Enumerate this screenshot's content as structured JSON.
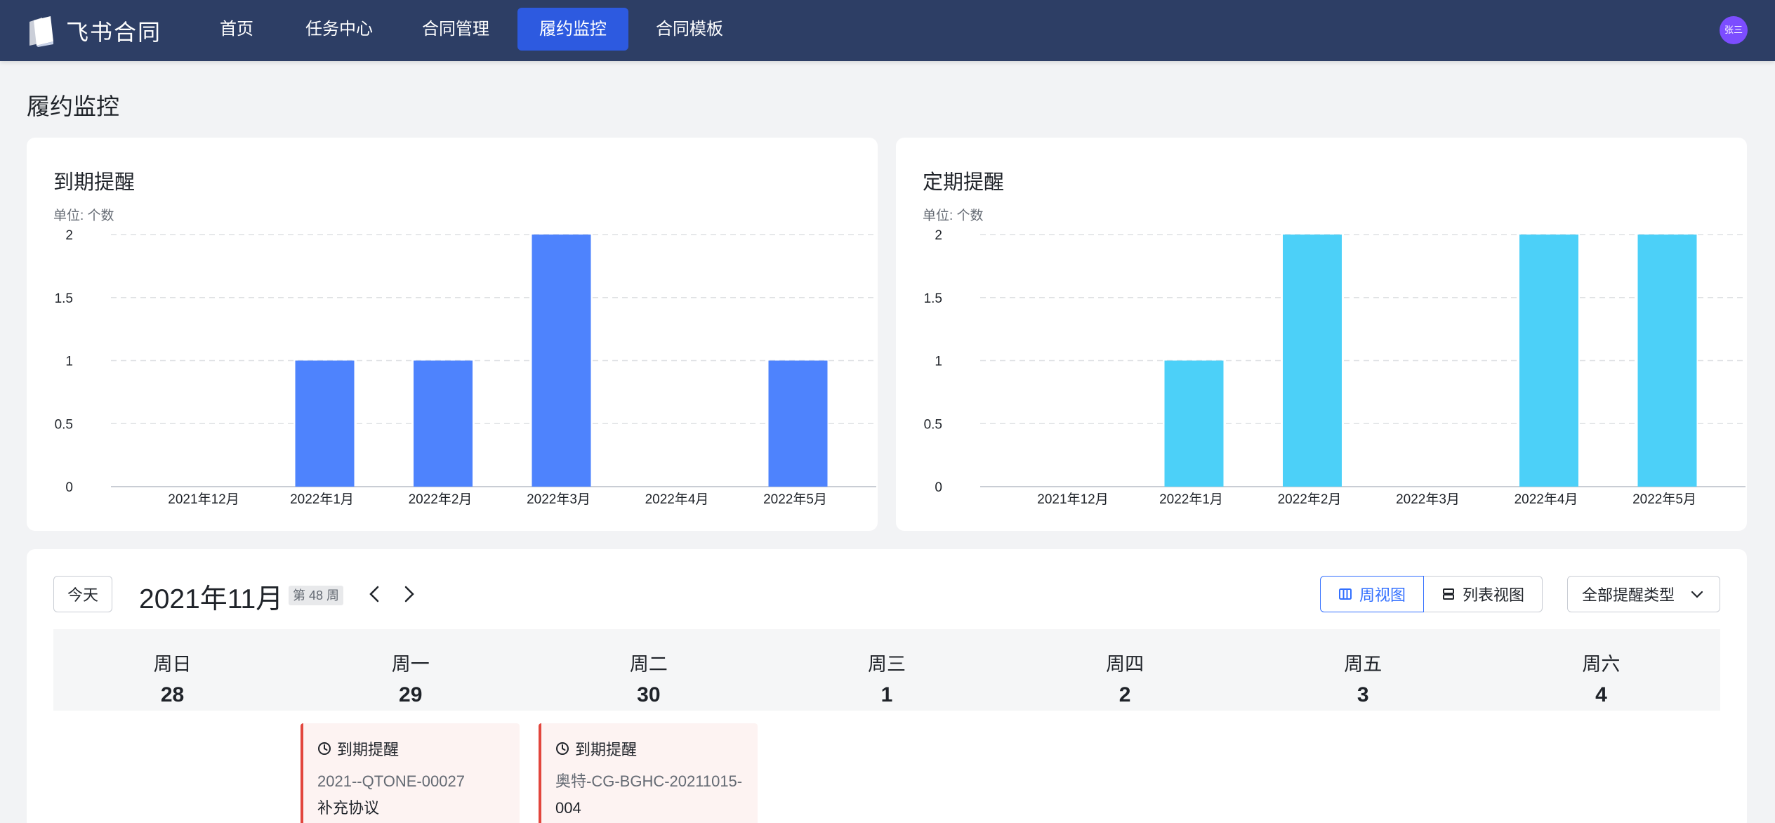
{
  "app": {
    "name": "飞书合同"
  },
  "nav": [
    {
      "label": "首页",
      "active": false
    },
    {
      "label": "任务中心",
      "active": false
    },
    {
      "label": "合同管理",
      "active": false
    },
    {
      "label": "履约监控",
      "active": true
    },
    {
      "label": "合同模板",
      "active": false
    }
  ],
  "user": {
    "avatar_text": "张三",
    "avatar_color": "#7c4dff"
  },
  "page": {
    "title": "履约监控"
  },
  "chart_data": [
    {
      "type": "bar",
      "title": "到期提醒",
      "unit_label": "单位: 个数",
      "categories": [
        "2021年12月",
        "2022年1月",
        "2022年2月",
        "2022年3月",
        "2022年4月",
        "2022年5月"
      ],
      "values": [
        0,
        1,
        1,
        2,
        0,
        1
      ],
      "yticks": [
        "0",
        "0.5",
        "1",
        "1.5",
        "2"
      ],
      "ylim": [
        0,
        2
      ],
      "color": "#4e83fd",
      "grid": true
    },
    {
      "type": "bar",
      "title": "定期提醒",
      "unit_label": "单位: 个数",
      "categories": [
        "2021年12月",
        "2022年1月",
        "2022年2月",
        "2022年3月",
        "2022年4月",
        "2022年5月"
      ],
      "values": [
        0,
        1,
        2,
        0,
        2,
        2
      ],
      "yticks": [
        "0",
        "0.5",
        "1",
        "1.5",
        "2"
      ],
      "ylim": [
        0,
        2
      ],
      "color": "#4cd0f8",
      "grid": true
    }
  ],
  "calendar": {
    "today_label": "今天",
    "month_title": "2021年11月",
    "week_tag": "第 48 周",
    "view_week_label": "周视图",
    "view_list_label": "列表视图",
    "filter_label": "全部提醒类型",
    "days": [
      {
        "name": "周日",
        "num": "28"
      },
      {
        "name": "周一",
        "num": "29"
      },
      {
        "name": "周二",
        "num": "30"
      },
      {
        "name": "周三",
        "num": "1"
      },
      {
        "name": "周四",
        "num": "2"
      },
      {
        "name": "周五",
        "num": "3"
      },
      {
        "name": "周六",
        "num": "4"
      }
    ],
    "events": [
      {
        "type": "到期提醒",
        "line1": "2021--QTONE-00027",
        "line2": "补充协议"
      },
      {
        "type": "到期提醒",
        "line1": "奥特-CG-BGHC-20211015-",
        "line2": "004"
      }
    ]
  }
}
